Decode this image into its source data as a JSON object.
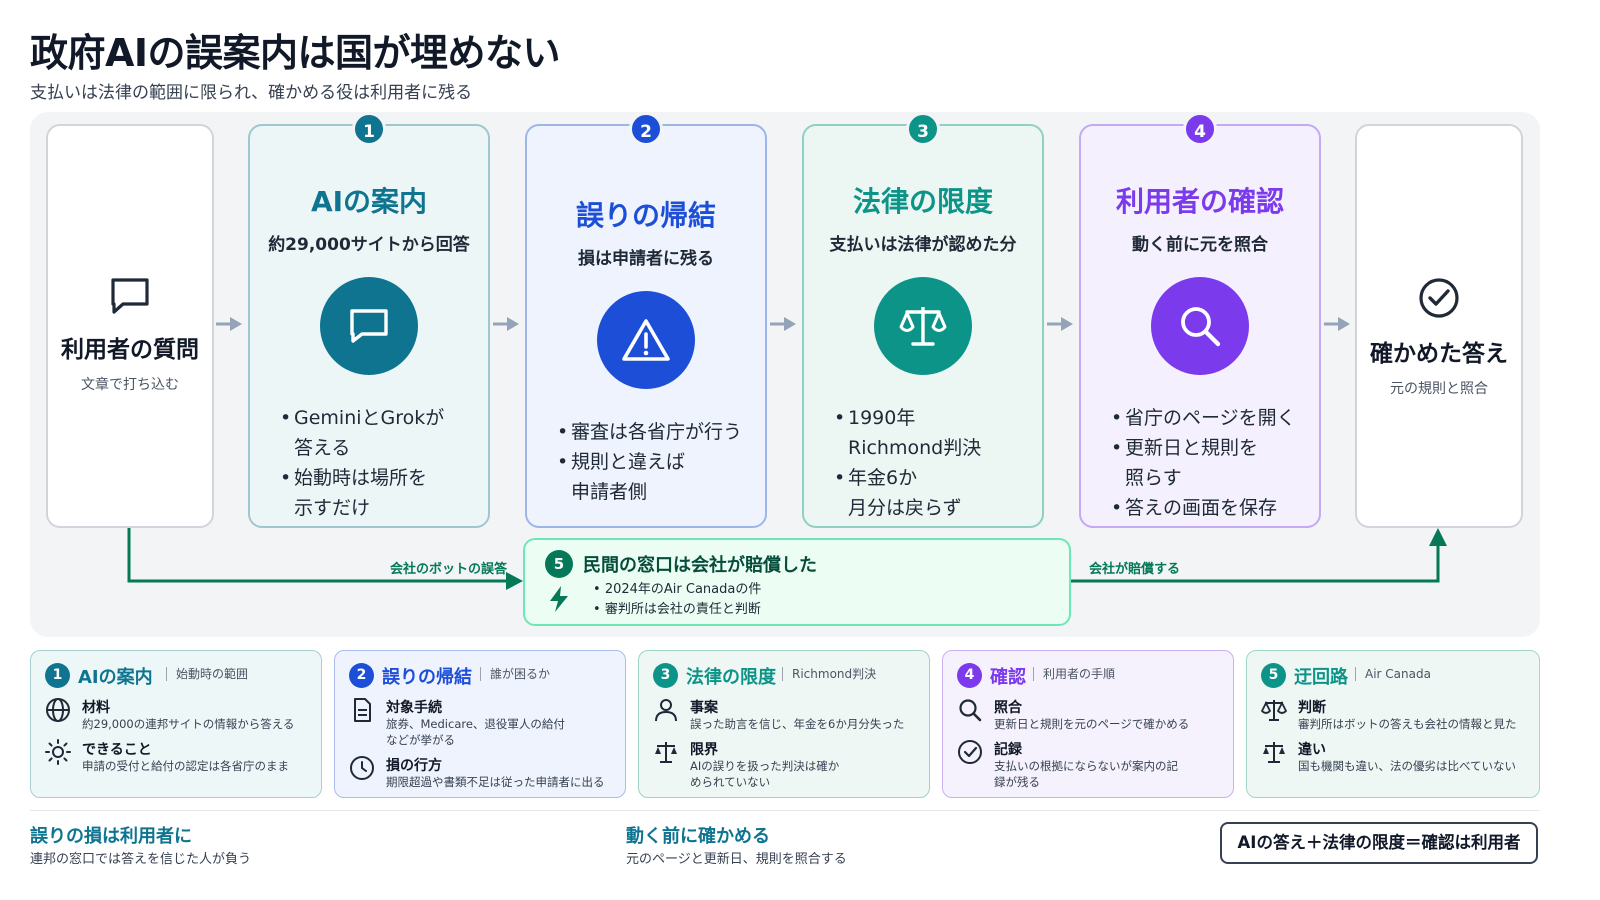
{
  "header": {
    "title": "政府AIの誤案内は国が埋めない",
    "subtitle": "支払いは法律の範囲に限られ、確かめる役は利用者に残る"
  },
  "colors": {
    "teal": "#0e7490",
    "blue": "#1d4ed8",
    "green": "#0d9488",
    "purple": "#7c3aed",
    "detour_green": "#047857"
  },
  "start": {
    "icon": "chat-bubble-icon",
    "title": "利用者の質問",
    "sub": "文章で打ち込む"
  },
  "end": {
    "icon": "check-circle-icon",
    "title": "確かめた答え",
    "sub": "元の規則と照合"
  },
  "steps": [
    {
      "num": "1",
      "title": "AIの案内",
      "sub": "約29,000サイトから回答",
      "icon": "chat-bubble-icon",
      "bullets": [
        [
          "GeminiとGrokが",
          "答える"
        ],
        [
          "始動時は場所を",
          "示すだけ"
        ]
      ]
    },
    {
      "num": "2",
      "title": "誤りの帰結",
      "sub": "損は申請者に残る",
      "icon": "warning-triangle-icon",
      "bullets": [
        [
          "審査は各省庁が行う"
        ],
        [
          "規則と違えば",
          "申請者側"
        ]
      ]
    },
    {
      "num": "3",
      "title": "法律の限度",
      "sub": "支払いは法律が認めた分",
      "icon": "scales-icon",
      "bullets": [
        [
          "1990年",
          "Richmond判決"
        ],
        [
          "年金6か",
          "月分は戻らず"
        ]
      ]
    },
    {
      "num": "4",
      "title": "利用者の確認",
      "sub": "動く前に元を照合",
      "icon": "search-icon",
      "bullets": [
        [
          "省庁のページを開く"
        ],
        [
          "更新日と規則を",
          "照らす"
        ],
        [
          "答えの画面を保存"
        ]
      ]
    }
  ],
  "detour": {
    "num": "5",
    "title": "民間の窓口は会社が賠償した",
    "icon": "lightning-icon",
    "bullets": [
      "2024年のAir Canadaの件",
      "審判所は会社の責任と判断"
    ],
    "left_label": "会社のボットの誤答",
    "right_label": "会社が賠償する"
  },
  "info_cards": [
    {
      "num": "1",
      "title": "AIの案内",
      "tag": "始動時の範囲",
      "rows": [
        {
          "icon": "globe-icon",
          "label": "材料",
          "text": "約29,000の連邦サイトの情報から答える"
        },
        {
          "icon": "sun-icon",
          "label": "できること",
          "text": "申請の受付と給付の認定は各省庁のまま"
        }
      ]
    },
    {
      "num": "2",
      "title": "誤りの帰結",
      "tag": "誰が困るか",
      "rows": [
        {
          "icon": "document-icon",
          "label": "対象手続",
          "text": "旅券、Medicare、退役軍人の給付などが挙がる"
        },
        {
          "icon": "clock-icon",
          "label": "損の行方",
          "text": "期限超過や書類不足は従った申請者に出る"
        }
      ]
    },
    {
      "num": "3",
      "title": "法律の限度",
      "tag": "Richmond判決",
      "rows": [
        {
          "icon": "person-icon",
          "label": "事案",
          "text": "誤った助言を信じ、年金を6か月分失った"
        },
        {
          "icon": "balance-icon",
          "label": "限界",
          "text": "AIの誤りを扱った判決は確かめられていない"
        }
      ]
    },
    {
      "num": "4",
      "title": "確認",
      "tag": "利用者の手順",
      "rows": [
        {
          "icon": "search-icon",
          "label": "照合",
          "text": "更新日と規則を元のページで確かめる"
        },
        {
          "icon": "check-circle-icon",
          "label": "記録",
          "text": "支払いの根拠にならないが案内の記録が残る"
        }
      ]
    },
    {
      "num": "5",
      "title": "迂回路",
      "tag": "Air Canada",
      "rows": [
        {
          "icon": "scales-icon",
          "label": "判断",
          "text": "審判所はボットの答えも会社の情報と見た"
        },
        {
          "icon": "balance-icon",
          "label": "違い",
          "text": "国も機関も違い、法の優劣は比べていない"
        }
      ]
    }
  ],
  "footer": {
    "left_title": "誤りの損は利用者に",
    "left_sub": "連邦の窓口では答えを信じた人が負う",
    "mid_title": "動く前に確かめる",
    "mid_sub": "元のページと更新日、規則を照合する",
    "formula": "AIの答え＋法律の限度＝確認は利用者"
  }
}
